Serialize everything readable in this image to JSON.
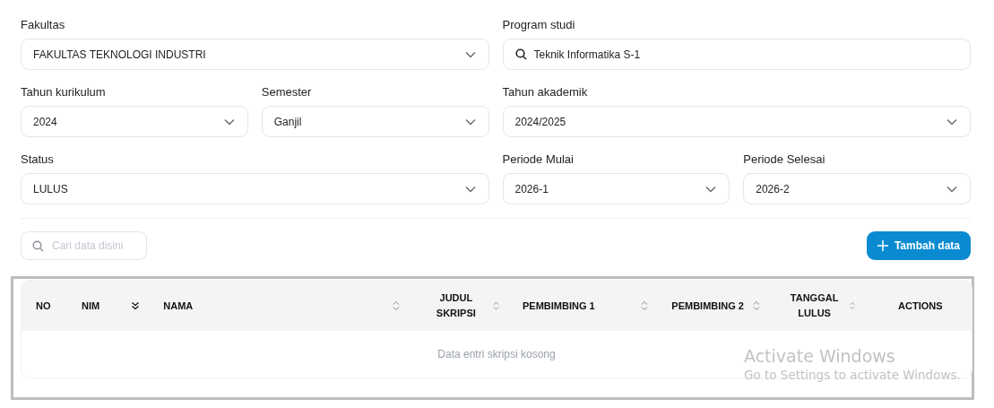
{
  "filters": [
    {
      "label": "Fakultas",
      "kind": "select",
      "value": "FAKULTAS TEKNOLOGI INDUSTRI"
    },
    {
      "label": "Program studi",
      "kind": "search",
      "value": "Teknik Informatika S-1"
    },
    {
      "label": "Tahun kurikulum",
      "kind": "select",
      "value": "2024"
    },
    {
      "label": "Semester",
      "kind": "select",
      "value": "Ganjil"
    },
    {
      "label": "Tahun akademik",
      "kind": "select",
      "value": "2024/2025"
    },
    {
      "label": "Status",
      "kind": "select",
      "value": "LULUS"
    },
    {
      "label": "Periode Mulai",
      "kind": "select",
      "value": "2026-1"
    },
    {
      "label": "Periode Selesai",
      "kind": "select",
      "value": "2026-2"
    }
  ],
  "search": {
    "placeholder": "Cari data disini"
  },
  "add_button": {
    "label": "Tambah data"
  },
  "table": {
    "columns": [
      {
        "label": "NO",
        "kind": "plain"
      },
      {
        "label": "NIM",
        "kind": "sorted"
      },
      {
        "label": "NAMA",
        "kind": "sortable"
      },
      {
        "label": "JUDUL SKRIPSI",
        "kind": "sortable"
      },
      {
        "label": "PEMBIMBING 1",
        "kind": "sortable"
      },
      {
        "label": "PEMBIMBING 2",
        "kind": "sortable"
      },
      {
        "label": "TANGGAL LULUS",
        "kind": "sortable"
      },
      {
        "label": "ACTIONS",
        "kind": "plain"
      }
    ],
    "empty_message": "Data entri skripsi kosong"
  },
  "os_notice": {
    "title": "Activate Windows",
    "subtitle": "Go to Settings to activate Windows."
  }
}
